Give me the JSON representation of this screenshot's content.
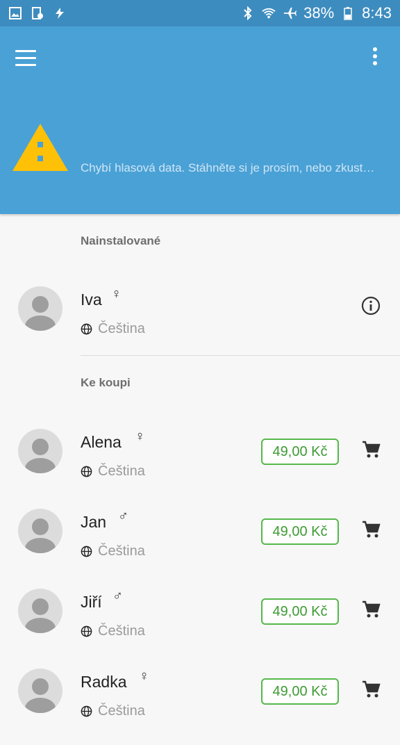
{
  "status_bar": {
    "battery": "38%",
    "time": "8:43",
    "icons_left": [
      "gallery-icon",
      "device-icon",
      "flash-icon"
    ],
    "icons_right": [
      "bluetooth-icon",
      "wifi-icon",
      "airplane-icon",
      "battery-icon"
    ]
  },
  "header": {
    "menu_icon": "hamburger-menu-icon",
    "more_icon": "more-vertical-icon",
    "warning_text": "Chybí hlasová data. Stáhněte si je prosím, nebo zkust…",
    "warning_color": "#ffc107",
    "background_color": "#4aa1d6"
  },
  "installed": {
    "title": "Nainstalované",
    "voices": [
      {
        "name": "Iva",
        "gender": "♀",
        "language": "Čeština"
      }
    ]
  },
  "purchase": {
    "title": "Ke koupi",
    "voices": [
      {
        "name": "Alena",
        "gender": "♀",
        "language": "Čeština",
        "price": "49,00 Kč"
      },
      {
        "name": "Jan",
        "gender": "♂",
        "language": "Čeština",
        "price": "49,00 Kč"
      },
      {
        "name": "Jiří",
        "gender": "♂",
        "language": "Čeština",
        "price": "49,00 Kč"
      },
      {
        "name": "Radka",
        "gender": "♀",
        "language": "Čeština",
        "price": "49,00 Kč"
      }
    ]
  },
  "colors": {
    "price_green": "#55b84a",
    "accent_blue": "#4aa1d6"
  }
}
